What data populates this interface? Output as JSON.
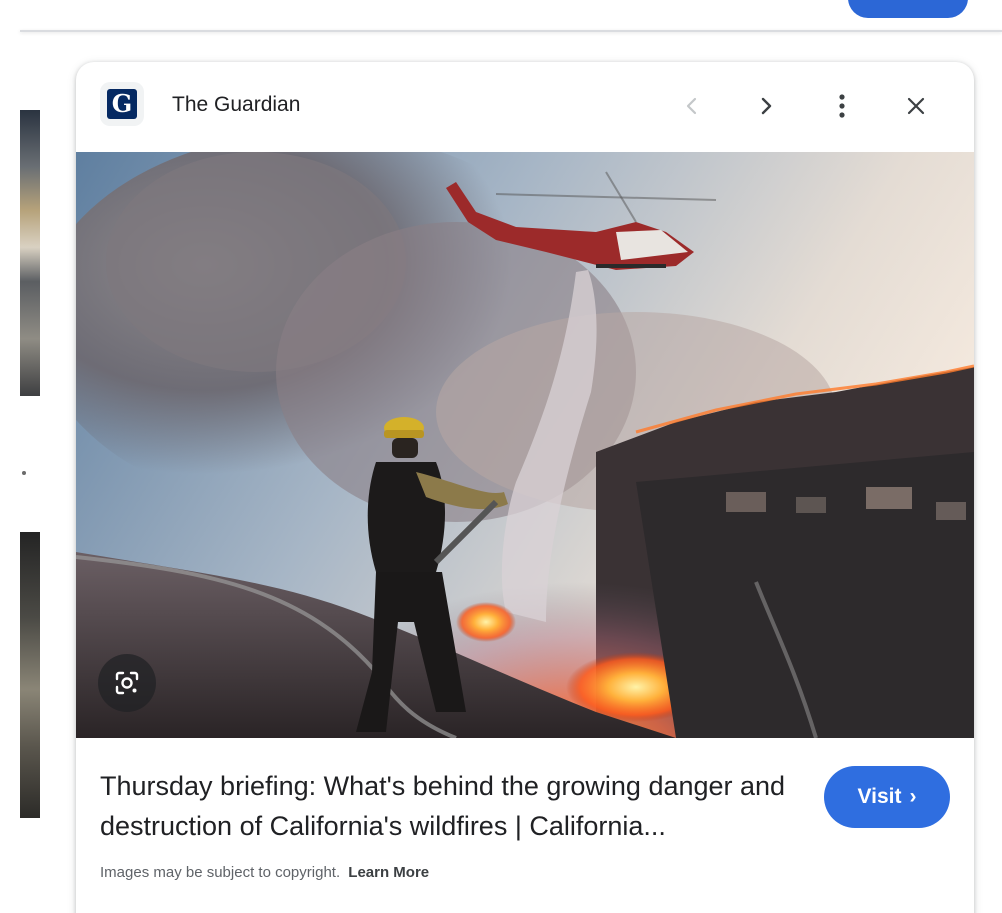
{
  "header": {
    "source_name": "The Guardian",
    "source_logo_letter": "G",
    "icons": {
      "prev": "chevron-left-icon",
      "next": "chevron-right-icon",
      "more": "more-vert-icon",
      "close": "close-icon"
    }
  },
  "image": {
    "lens_icon": "lens-icon"
  },
  "result": {
    "headline": "Thursday briefing: What's behind the growing danger and destruction of California's wildfires | California...",
    "visit_label": "Visit",
    "visit_chevron": "›"
  },
  "footer": {
    "copyright_text": "Images may be subject to copyright.",
    "learn_more_label": "Learn More"
  },
  "colors": {
    "accent": "#2f6ee0",
    "text_primary": "#202124",
    "text_secondary": "#5f6368",
    "guardian_blue": "#052962"
  }
}
